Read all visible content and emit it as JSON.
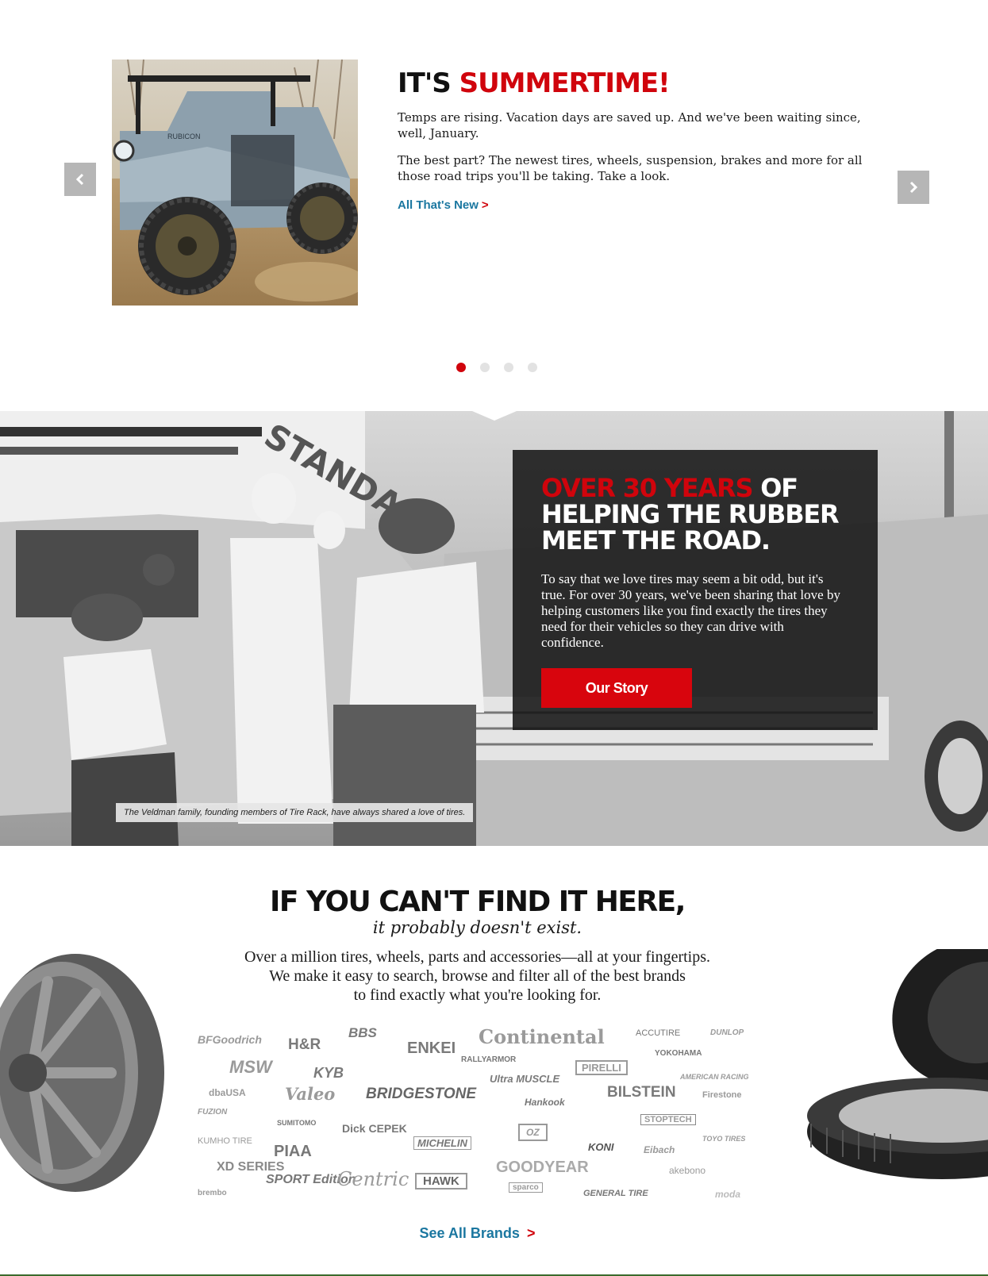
{
  "carousel": {
    "title_part1": "IT'S ",
    "title_part2": "SUMMERTIME!",
    "paragraph1": "Temps are rising. Vacation days are saved up. And we've been waiting since, well, January.",
    "paragraph2": "The best part? The newest tires, wheels, suspension, brakes and more for all those road trips you'll be taking. Take a look.",
    "link_label": "All That's New",
    "link_caret": ">",
    "photo_text": "RUBICON",
    "slide_count": 4,
    "active_slide": 1
  },
  "history": {
    "title_red": "OVER 30 YEARS",
    "title_white_1": " OF",
    "title_white_2": "HELPING THE RUBBER",
    "title_white_3": "MEET THE ROAD.",
    "paragraph": "To say that we love tires may seem a bit odd, but it's true. For over 30 years, we've been sharing that love by helping customers like you find exactly the tires they need for their vehicles so they can drive with confidence.",
    "button_label": "Our Story",
    "caption": "The Veldman family, founding members of Tire Rack, have always shared a love of tires.",
    "sign_text": "STANDARD"
  },
  "brands": {
    "title": "IF YOU CAN'T FIND IT HERE,",
    "subtitle": "it probably doesn't exist.",
    "line1": "Over a million tires, wheels, parts and accessories—all at your fingertips.",
    "line2": "We make it easy to search, browse and filter all of the best brands",
    "line3": "to find exactly what you're looking for.",
    "see_all_label": "See All Brands",
    "see_all_caret": ">",
    "logos": [
      "BFGoodrich",
      "H&R",
      "BBS",
      "ENKEI",
      "Continental",
      "ACCUTIRE",
      "DUNLOP",
      "MSW",
      "KYB",
      "RALLYARMOR",
      "YOKOHAMA",
      "PIRELLI",
      "Ultra MUSCLE",
      "AMERICAN RACING",
      "dbaUSA",
      "Valeo",
      "BRIDGESTONE",
      "Hankook",
      "BILSTEIN",
      "Firestone",
      "FUZION",
      "SUMITOMO",
      "STOPTECH",
      "KUMHO TIRE",
      "Dick CEPEK",
      "OZ",
      "TOYO TIRES",
      "PIAA",
      "MICHELIN",
      "KONI",
      "Eibach",
      "XD SERIES",
      "GOODYEAR",
      "akebono",
      "SPORT Edition",
      "Centric",
      "HAWK",
      "sparco",
      "GENERAL TIRE",
      "brembo",
      "moda"
    ]
  },
  "colors": {
    "accent_red": "#d0040c",
    "link_blue": "#1b77a0",
    "arrow_gray": "#b6b6b6",
    "logo_gray": "#9a9a9a"
  },
  "icons": {
    "prev": "chevron-left-icon",
    "next": "chevron-right-icon"
  }
}
